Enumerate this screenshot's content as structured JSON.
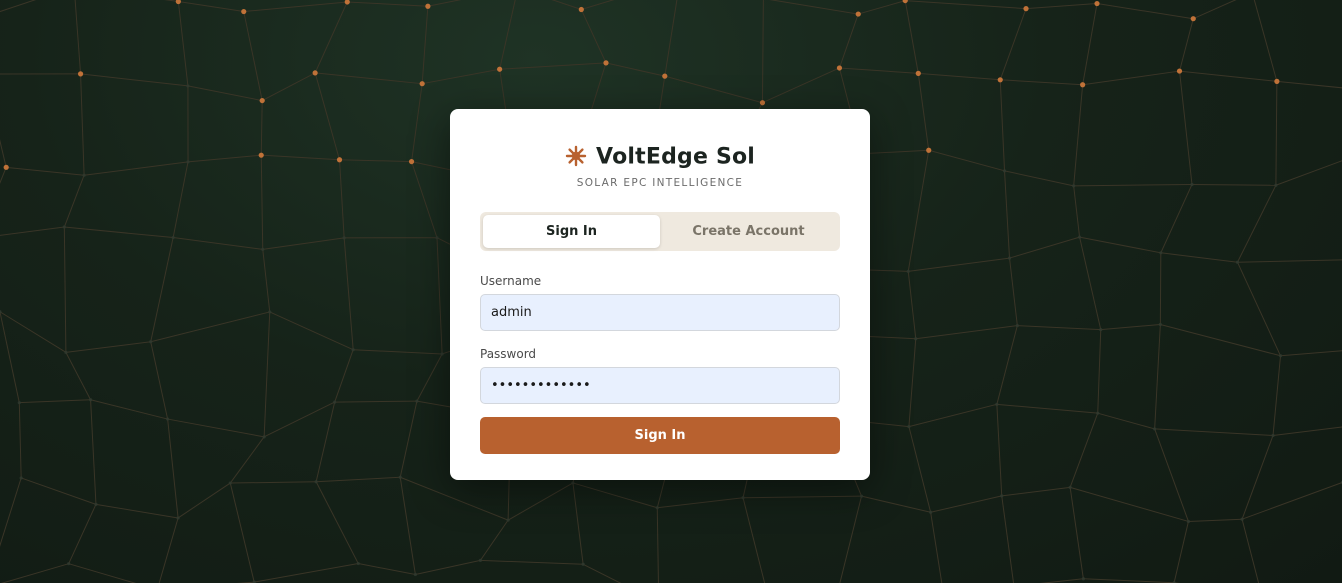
{
  "colors": {
    "background_dark": "#162319",
    "network_line": "#3a3527",
    "network_node": "#c8763a",
    "card_bg": "#ffffff",
    "accent": "#b8612f",
    "tab_bar_bg": "#efe9df",
    "input_bg": "#e8f0fe"
  },
  "brand": {
    "icon": "sun-icon",
    "name": "VoltEdge Sol",
    "tagline": "SOLAR EPC INTELLIGENCE"
  },
  "tabs": [
    {
      "label": "Sign In",
      "active": true
    },
    {
      "label": "Create Account",
      "active": false
    }
  ],
  "form": {
    "username": {
      "label": "Username",
      "value": "admin"
    },
    "password": {
      "label": "Password",
      "value": "•••••••••••••"
    },
    "submit_label": "Sign In"
  }
}
